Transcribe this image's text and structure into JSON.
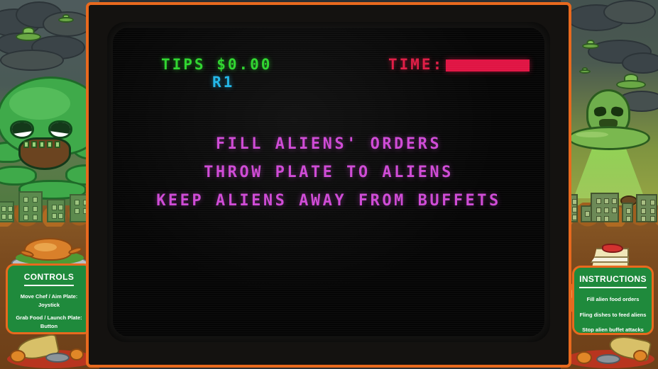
{
  "hud": {
    "tips_label": "TIPS",
    "tips_value": "$0.00",
    "round": "R1",
    "time_label": "TIME:",
    "time_bar_percent": 100,
    "tips_color": "#2fd62f",
    "round_color": "#22b7e8",
    "time_color": "#e01443"
  },
  "screen": {
    "messages": [
      "FILL ALIENS' ORDERS",
      "THROW PLATE TO ALIENS",
      "KEEP ALIENS AWAY FROM BUFFETS"
    ],
    "message_color": "#cf4ad6",
    "background_color": "#050505"
  },
  "cabinet": {
    "frame_color": "#e8691e",
    "panel_color": "#1f8a3c"
  },
  "controls_panel": {
    "title": "CONTROLS",
    "entries": [
      {
        "action": "Move Chef / Aim Plate:",
        "input": "Joystick"
      },
      {
        "action": "Grab Food / Launch Plate:",
        "input": "Button"
      }
    ]
  },
  "instructions_panel": {
    "title": "INSTRUCTIONS",
    "lines": [
      "Fill alien food orders",
      "Fling dishes to feed aliens",
      "Stop alien buffet attacks"
    ]
  },
  "artwork": {
    "left": {
      "monster": "green-octopus-alien",
      "scene": "storm-clouds-ufos-city-skyline",
      "food_prop_top": "roast-turkey-platter",
      "food_prop_bottom": "cornucopia"
    },
    "right": {
      "monster": "green-alien-in-flying-saucer",
      "scene": "clouds-ufos-flying-food-city-skyline",
      "food_prop_top": "strawberry-cake-slice",
      "food_prop_side": "turkey-drumstick",
      "food_prop_bottom": "cornucopia"
    }
  }
}
